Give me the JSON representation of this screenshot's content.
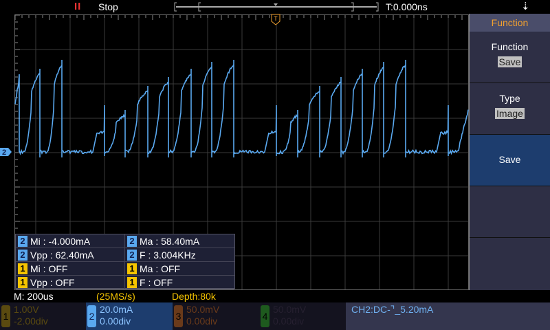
{
  "top": {
    "run_icon": "pause-bars-icon",
    "state": "Stop",
    "trigger_pos": "T:0.000ns",
    "usb_icon": "usb-icon",
    "trigger_marker": "T"
  },
  "panel": {
    "title": "Function",
    "items": [
      {
        "label": "Function",
        "value": "Save"
      },
      {
        "label": "Type",
        "value": "Image"
      },
      {
        "label": "Save"
      }
    ]
  },
  "measurements": [
    [
      {
        "ch": "2",
        "text": "Mi : -4.000mA"
      },
      {
        "ch": "2",
        "text": "Ma : 58.40mA"
      }
    ],
    [
      {
        "ch": "2",
        "text": "Vpp : 62.40mA"
      },
      {
        "ch": "2",
        "text": "F : 3.004KHz"
      }
    ],
    [
      {
        "ch": "1",
        "text": "Mi : OFF"
      },
      {
        "ch": "1",
        "text": "Ma : OFF"
      }
    ],
    [
      {
        "ch": "1",
        "text": "Vpp : OFF"
      },
      {
        "ch": "1",
        "text": "F : OFF"
      }
    ]
  ],
  "status": {
    "timebase": "M: 200us",
    "sample_rate": "(25MS/s)",
    "depth": "Depth:80k"
  },
  "channels": [
    {
      "n": "1",
      "scale": "1.00V",
      "offset": "-2.00div",
      "color": "#5a4a10"
    },
    {
      "n": "2",
      "scale": "20.0mA",
      "offset": "0.00div",
      "color": "#5aa9f0"
    },
    {
      "n": "3",
      "scale": "50.0mV",
      "offset": "0.00div",
      "color": "#6a3a1a"
    },
    {
      "n": "4",
      "scale": "50.0mV",
      "offset": "0.00div",
      "color": "#1e5a1e"
    }
  ],
  "trigger": {
    "text": "CH2:DC-",
    "level": "5.20mA"
  },
  "ch2_marker": "2",
  "colors": {
    "trace": "#5aa9f0",
    "accent": "#f0a030"
  }
}
